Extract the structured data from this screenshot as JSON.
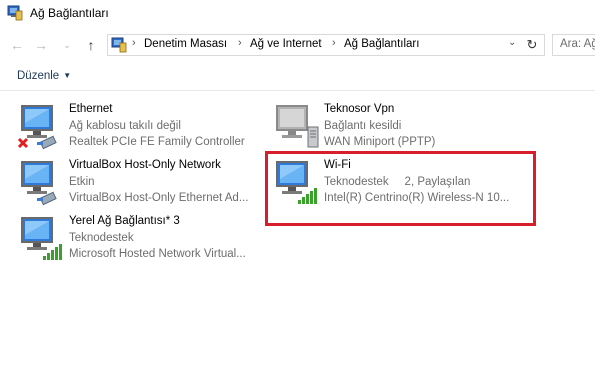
{
  "window": {
    "title": "Ağ Bağlantıları"
  },
  "address": {
    "crumbs": [
      "Denetim Masası",
      "Ağ ve Internet",
      "Ağ Bağlantıları"
    ],
    "search_placeholder": "Ara: Ağ"
  },
  "toolbar": {
    "organize_label": "Düzenle"
  },
  "connections": [
    {
      "name": "Ethernet",
      "line2": "Ağ kablosu takılı değil",
      "line3": "Realtek PCIe FE Family Controller",
      "icon": "ethernet-disconnected-icon"
    },
    {
      "name": "Teknosor Vpn",
      "line2": "Bağlantı kesildi",
      "line3": "WAN Miniport (PPTP)",
      "icon": "vpn-icon"
    },
    {
      "name": "VirtualBox Host-Only Network",
      "line2": "Etkin",
      "line3": "VirtualBox Host-Only Ethernet Ad...",
      "icon": "ethernet-icon"
    },
    {
      "name": "Wi-Fi",
      "line2": "Teknodestek     2, Paylaşılan",
      "line3": "Intel(R) Centrino(R) Wireless-N 10...",
      "icon": "wifi-signal-icon"
    },
    {
      "name": "Yerel Ağ Bağlantısı* 3",
      "line2": "Teknodestek",
      "line3": "Microsoft Hosted Network Virtual...",
      "icon": "wifi-signal-icon"
    }
  ],
  "colors": {
    "highlight": "#d51f2a",
    "signal": "#3aa22c",
    "link": "#1e395b"
  }
}
